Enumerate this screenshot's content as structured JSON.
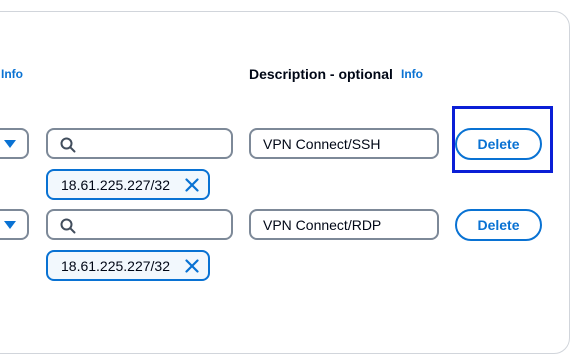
{
  "header": {
    "left_info_label": "Info",
    "description_label": "Description - optional",
    "description_info_label": "Info"
  },
  "rows": [
    {
      "search_value": "",
      "token_label": "18.61.225.227/32",
      "description_value": "VPN Connect/SSH",
      "delete_label": "Delete",
      "highlighted": true
    },
    {
      "search_value": "",
      "token_label": "18.61.225.227/32",
      "description_value": "VPN Connect/RDP",
      "delete_label": "Delete",
      "highlighted": false
    }
  ],
  "colors": {
    "accent": "#0972d3",
    "border": "#7d8998",
    "highlight": "#0b1fd6",
    "token_bg": "#f2f8fd"
  }
}
